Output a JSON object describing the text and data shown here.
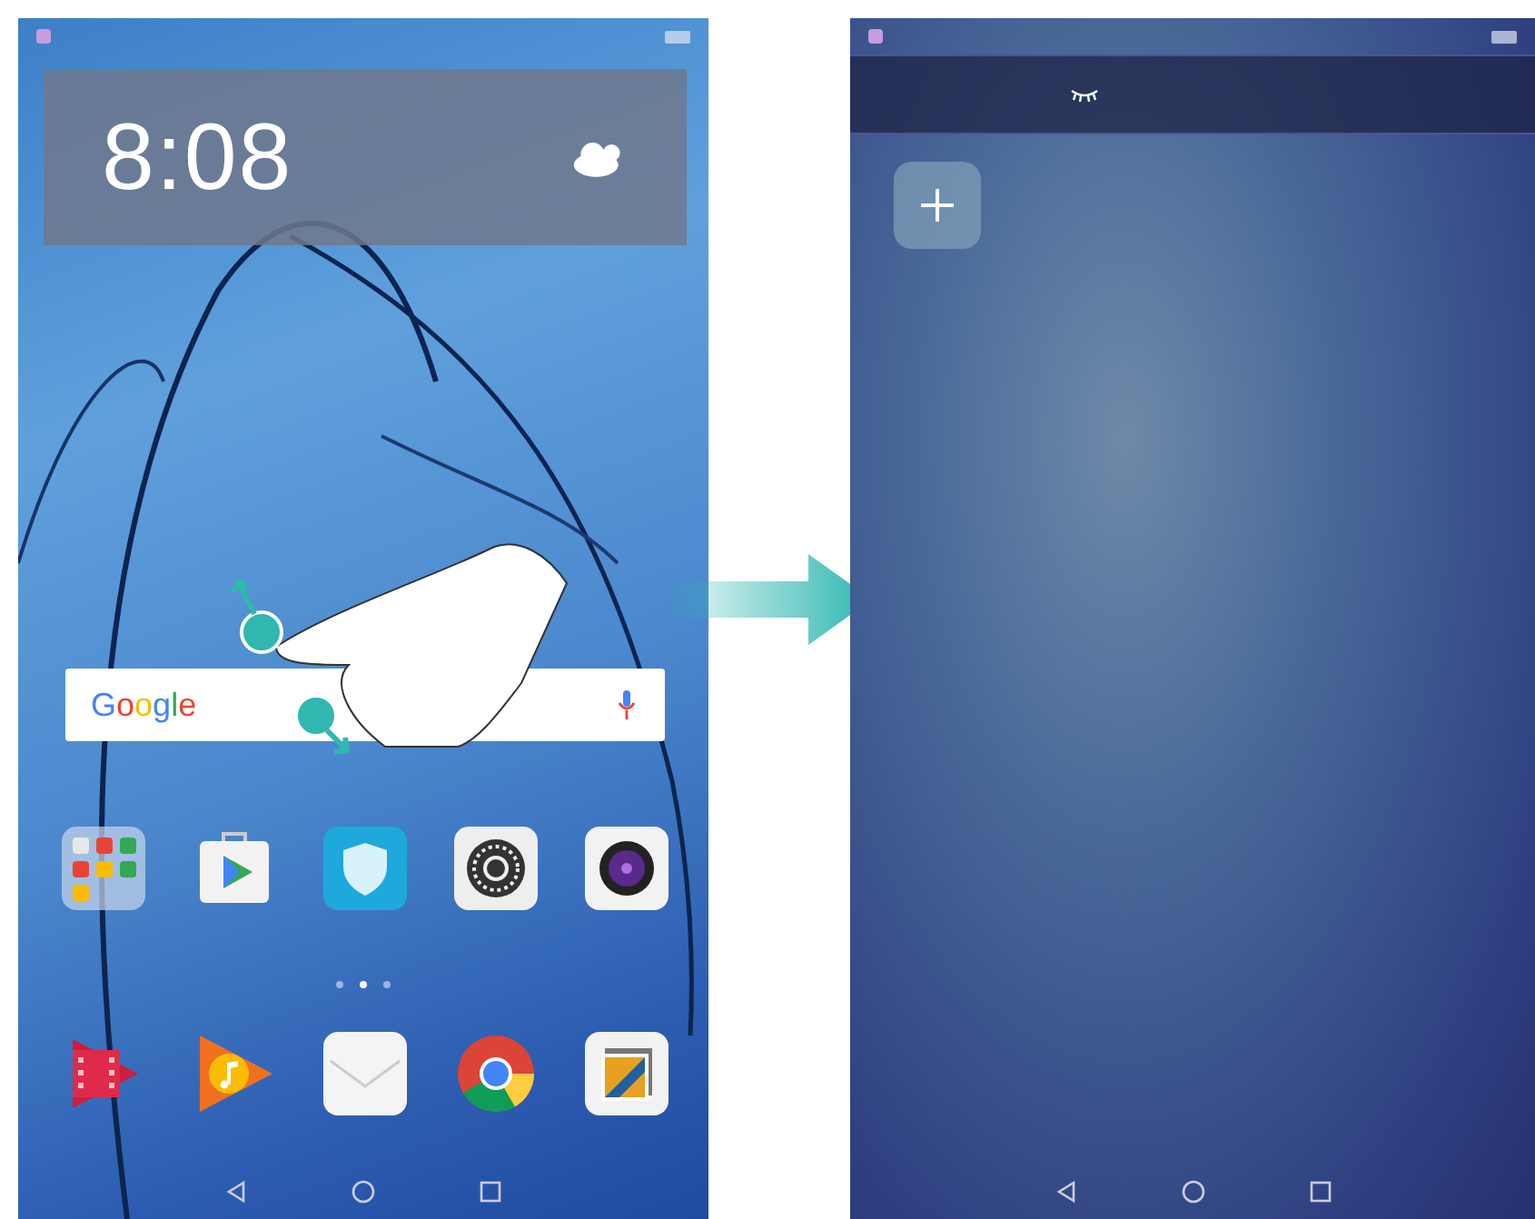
{
  "home_screen": {
    "clock": "8:08",
    "search_bar": {
      "logo": "Google"
    },
    "page_dots": [
      {
        "selected": false
      },
      {
        "selected": true
      },
      {
        "selected": false
      }
    ]
  }
}
